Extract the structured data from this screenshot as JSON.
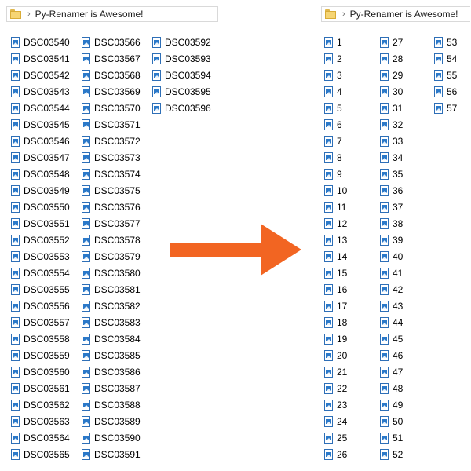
{
  "left_window": {
    "breadcrumb": "Py-Renamer is Awesome!",
    "columns": [
      [
        "DSC03540",
        "DSC03541",
        "DSC03542",
        "DSC03543",
        "DSC03544",
        "DSC03545",
        "DSC03546",
        "DSC03547",
        "DSC03548",
        "DSC03549",
        "DSC03550",
        "DSC03551",
        "DSC03552",
        "DSC03553",
        "DSC03554",
        "DSC03555",
        "DSC03556",
        "DSC03557",
        "DSC03558",
        "DSC03559",
        "DSC03560",
        "DSC03561",
        "DSC03562",
        "DSC03563",
        "DSC03564",
        "DSC03565"
      ],
      [
        "DSC03566",
        "DSC03567",
        "DSC03568",
        "DSC03569",
        "DSC03570",
        "DSC03571",
        "DSC03572",
        "DSC03573",
        "DSC03574",
        "DSC03575",
        "DSC03576",
        "DSC03577",
        "DSC03578",
        "DSC03579",
        "DSC03580",
        "DSC03581",
        "DSC03582",
        "DSC03583",
        "DSC03584",
        "DSC03585",
        "DSC03586",
        "DSC03587",
        "DSC03588",
        "DSC03589",
        "DSC03590",
        "DSC03591"
      ],
      [
        "DSC03592",
        "DSC03593",
        "DSC03594",
        "DSC03595",
        "DSC03596"
      ]
    ]
  },
  "right_window": {
    "breadcrumb": "Py-Renamer is Awesome!",
    "columns": [
      [
        "1",
        "2",
        "3",
        "4",
        "5",
        "6",
        "7",
        "8",
        "9",
        "10",
        "11",
        "12",
        "13",
        "14",
        "15",
        "16",
        "17",
        "18",
        "19",
        "20",
        "21",
        "22",
        "23",
        "24",
        "25",
        "26"
      ],
      [
        "27",
        "28",
        "29",
        "30",
        "31",
        "32",
        "33",
        "34",
        "35",
        "36",
        "37",
        "38",
        "39",
        "40",
        "41",
        "42",
        "43",
        "44",
        "45",
        "46",
        "47",
        "48",
        "49",
        "50",
        "51",
        "52"
      ],
      [
        "53",
        "54",
        "55",
        "56",
        "57"
      ]
    ]
  },
  "colors": {
    "arrow": "#f26522",
    "file_icon_border": "#2e6fb7",
    "folder": "#f6d574"
  },
  "icons": {
    "folder": "folder-icon",
    "file": "image-file-icon",
    "separator": "chevron-right-icon",
    "transition": "arrow-right-icon"
  }
}
